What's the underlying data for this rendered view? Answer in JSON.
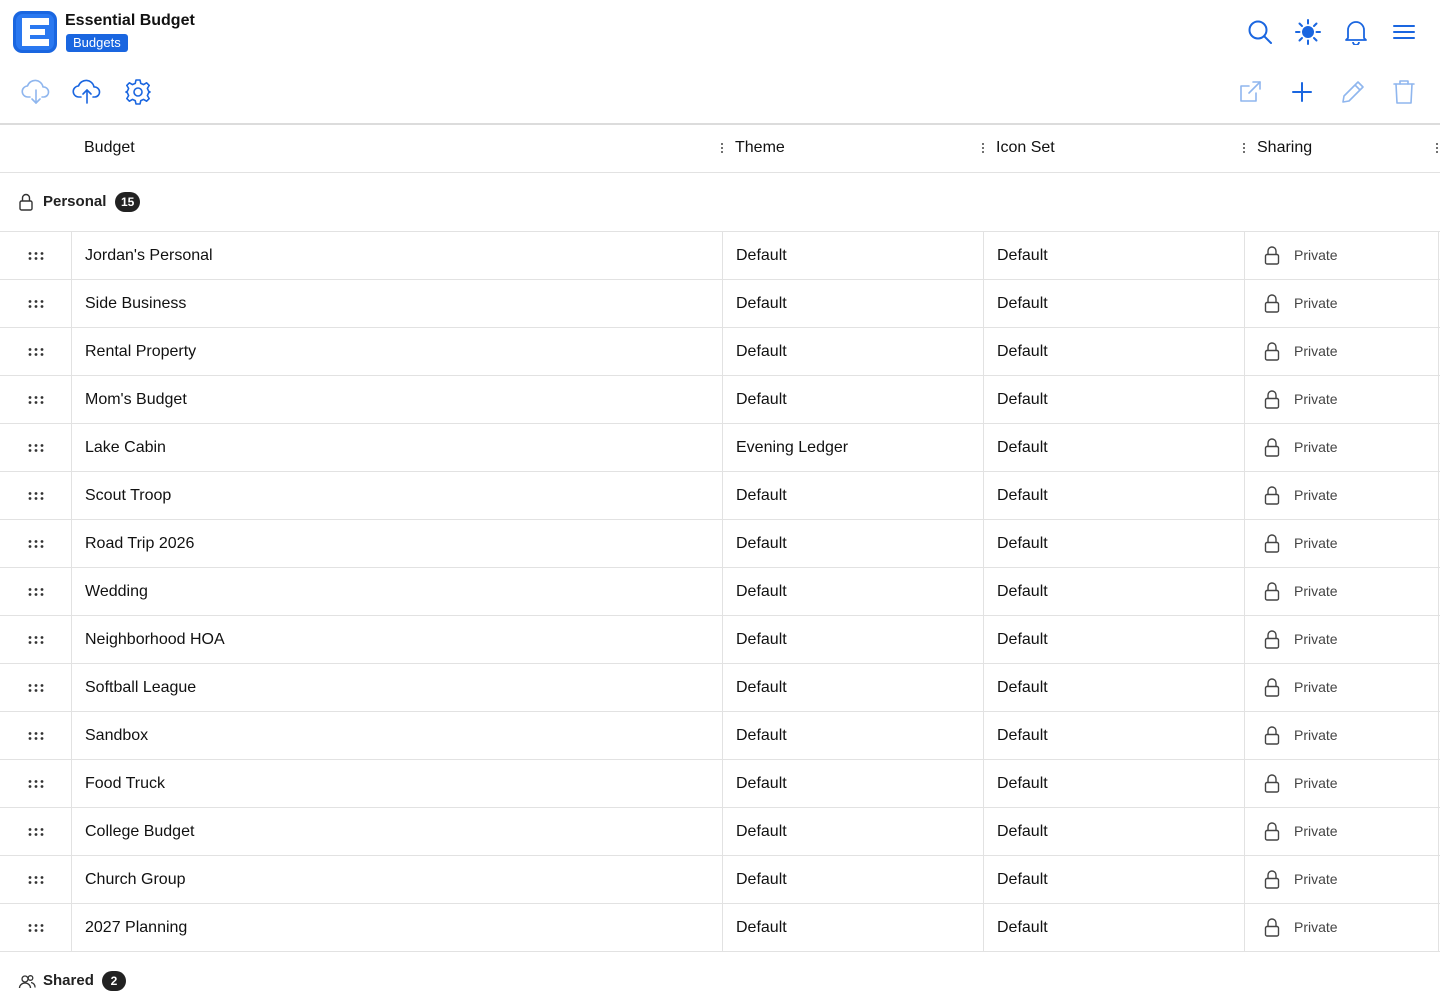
{
  "app": {
    "title": "Essential Budget",
    "page_badge": "Budgets",
    "accent_color": "#1a66e0"
  },
  "header_icons": [
    "search-icon",
    "theme-sun-icon",
    "notifications-bell-icon",
    "menu-hamburger-icon"
  ],
  "toolbar": {
    "left": [
      "cloud-download-icon",
      "cloud-upload-icon",
      "settings-gear-icon"
    ],
    "right": [
      "open-external-icon",
      "add-plus-icon",
      "edit-pencil-icon",
      "delete-trash-icon"
    ]
  },
  "columns": {
    "budget": "Budget",
    "theme": "Theme",
    "icon_set": "Icon Set",
    "sharing": "Sharing"
  },
  "groups": {
    "personal": {
      "label": "Personal",
      "count": "15",
      "icon": "lock-icon"
    },
    "shared": {
      "label": "Shared",
      "count": "2",
      "icon": "users-icon"
    }
  },
  "rows": [
    {
      "name": "Jordan's Personal",
      "theme": "Default",
      "icon_set": "Default",
      "sharing": "Private"
    },
    {
      "name": "Side Business",
      "theme": "Default",
      "icon_set": "Default",
      "sharing": "Private"
    },
    {
      "name": "Rental Property",
      "theme": "Default",
      "icon_set": "Default",
      "sharing": "Private"
    },
    {
      "name": "Mom's Budget",
      "theme": "Default",
      "icon_set": "Default",
      "sharing": "Private"
    },
    {
      "name": "Lake Cabin",
      "theme": "Evening Ledger",
      "icon_set": "Default",
      "sharing": "Private"
    },
    {
      "name": "Scout Troop",
      "theme": "Default",
      "icon_set": "Default",
      "sharing": "Private"
    },
    {
      "name": "Road Trip 2026",
      "theme": "Default",
      "icon_set": "Default",
      "sharing": "Private"
    },
    {
      "name": "Wedding",
      "theme": "Default",
      "icon_set": "Default",
      "sharing": "Private"
    },
    {
      "name": "Neighborhood HOA",
      "theme": "Default",
      "icon_set": "Default",
      "sharing": "Private"
    },
    {
      "name": "Softball League",
      "theme": "Default",
      "icon_set": "Default",
      "sharing": "Private"
    },
    {
      "name": "Sandbox",
      "theme": "Default",
      "icon_set": "Default",
      "sharing": "Private"
    },
    {
      "name": "Food Truck",
      "theme": "Default",
      "icon_set": "Default",
      "sharing": "Private"
    },
    {
      "name": "College Budget",
      "theme": "Default",
      "icon_set": "Default",
      "sharing": "Private"
    },
    {
      "name": "Church Group",
      "theme": "Default",
      "icon_set": "Default",
      "sharing": "Private"
    },
    {
      "name": "2027 Planning",
      "theme": "Default",
      "icon_set": "Default",
      "sharing": "Private"
    }
  ]
}
